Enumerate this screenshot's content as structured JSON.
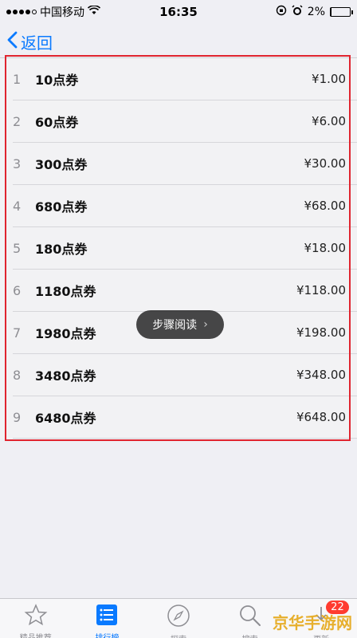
{
  "status_bar": {
    "carrier": "中国移动",
    "time": "16:35",
    "battery": "2%",
    "battery_level": 0.02,
    "icons": [
      "signal-dots",
      "wifi-icon",
      "orientation-lock-icon",
      "alarm-icon",
      "battery-icon"
    ]
  },
  "nav": {
    "back_label": "返回"
  },
  "items": [
    {
      "index": "1",
      "name": "10点券",
      "price": "¥1.00"
    },
    {
      "index": "2",
      "name": "60点券",
      "price": "¥6.00"
    },
    {
      "index": "3",
      "name": "300点券",
      "price": "¥30.00"
    },
    {
      "index": "4",
      "name": "680点券",
      "price": "¥68.00"
    },
    {
      "index": "5",
      "name": "180点券",
      "price": "¥18.00"
    },
    {
      "index": "6",
      "name": "1180点券",
      "price": "¥118.00"
    },
    {
      "index": "7",
      "name": "1980点券",
      "price": "¥198.00"
    },
    {
      "index": "8",
      "name": "3480点券",
      "price": "¥348.00"
    },
    {
      "index": "9",
      "name": "6480点券",
      "price": "¥648.00"
    }
  ],
  "toast": {
    "label": "步骤阅读"
  },
  "tabs": [
    {
      "label": "精品推荐",
      "icon": "star-icon",
      "active": false
    },
    {
      "label": "排行榜",
      "icon": "list-icon",
      "active": true
    },
    {
      "label": "探索",
      "icon": "compass-icon",
      "active": false
    },
    {
      "label": "搜索",
      "icon": "search-icon",
      "active": false
    },
    {
      "label": "更新",
      "icon": "update-icon",
      "active": false,
      "badge": "22"
    }
  ],
  "watermark": "京华手游网",
  "colors": {
    "accent": "#0a7aff",
    "highlight": "#e0242f",
    "badge": "#ff3b30"
  }
}
